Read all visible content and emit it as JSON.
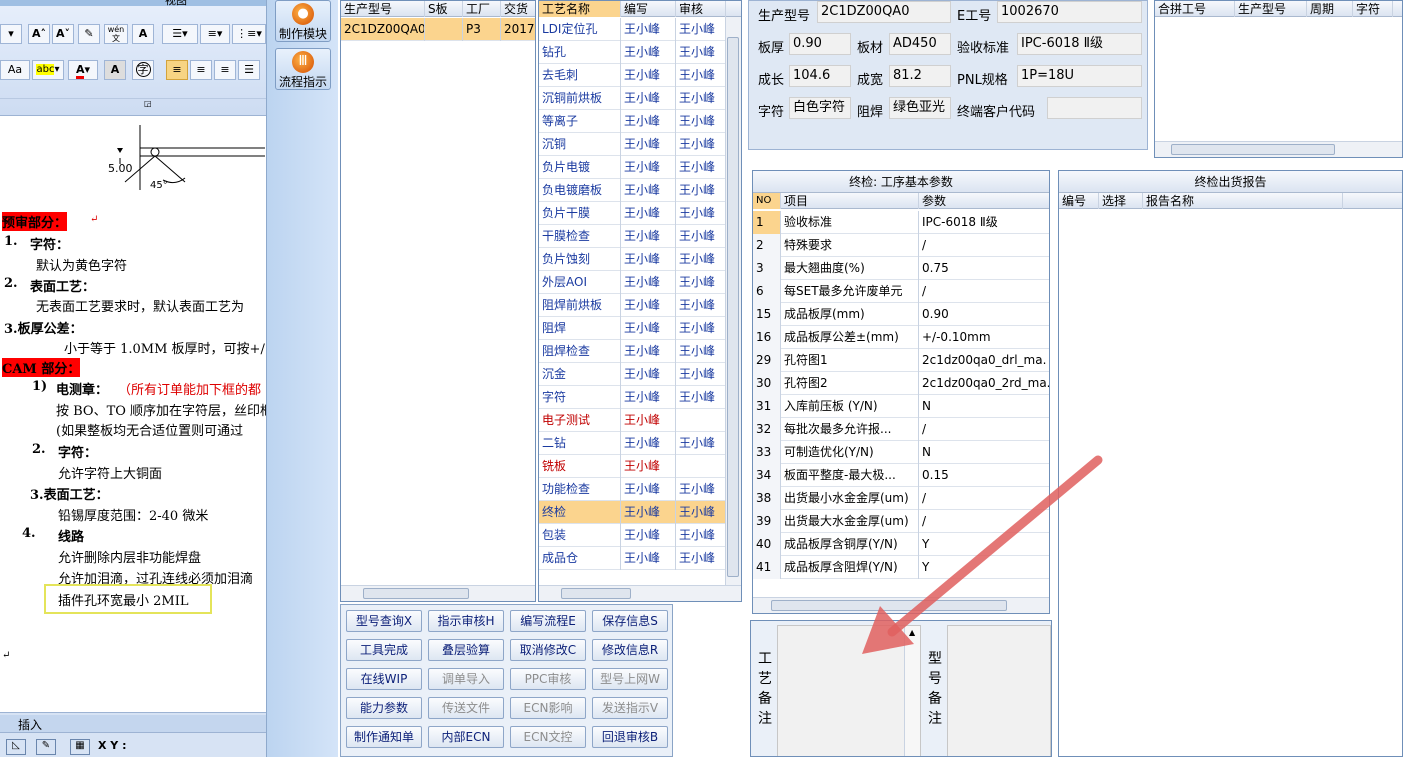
{
  "word": {
    "ribbon_tabs": [
      "视图"
    ],
    "ribbon": {
      "size_up": "A",
      "size_down": "A",
      "font_a": "A",
      "case_aa": "Aa",
      "abc": "abc",
      "font_color_a": "A",
      "char_a": "A",
      "circle": "字"
    },
    "doc": {
      "dim_label": "5.00",
      "angle_label": "45°",
      "s1": "预审部分：",
      "i1_num": "1.",
      "i1": "字符：",
      "i1_text": "默认为黄色字符",
      "i2_num": "2.",
      "i2": "表面工艺：",
      "i2_text": "无表面工艺要求时，默认表面工艺为",
      "i3": "3.板厚公差：",
      "i3_text": "小于等于 1.0MM 板厚时，可按+/",
      "s2": "CAM 部分：",
      "c1_num": "1)",
      "c1": "电测章：",
      "c1_red": "（所有订单能加下框的都",
      "c1_t1": "按 BO、TO 顺序加在字符层，丝印框",
      "c1_t2": "(如果整板均无合适位置则可通过",
      "c2_num": "2.",
      "c2": "字符：",
      "c2_t": "允许字符上大铜面",
      "c3": "3.表面工艺：",
      "c3_t": "铅锡厚度范围：2-40 微米",
      "c4_num": "4.",
      "c4": "线路",
      "c4_t1": "允许删除内层非功能焊盘",
      "c4_t2": "允许加泪滴，过孔连线必须加泪滴",
      "c4_t3": "插件孔环宽最小 2MIL"
    },
    "status": {
      "insert": "插入",
      "xy": "X Y :"
    }
  },
  "strip": {
    "make_module": "制作模块",
    "flow_guide": "流程指示"
  },
  "model_grid": {
    "headers": [
      "生产型号",
      "S板",
      "工厂",
      "交货"
    ],
    "rows": [
      [
        "2C1DZ00QA0",
        "",
        "P3",
        "2017"
      ]
    ]
  },
  "process_grid": {
    "headers": [
      "工艺名称",
      "编写",
      "审核"
    ],
    "rows": [
      [
        "LDI定位孔",
        "王小峰",
        "王小峰"
      ],
      [
        "钻孔",
        "王小峰",
        "王小峰"
      ],
      [
        "去毛刺",
        "王小峰",
        "王小峰"
      ],
      [
        "沉铜前烘板",
        "王小峰",
        "王小峰"
      ],
      [
        "等离子",
        "王小峰",
        "王小峰"
      ],
      [
        "沉铜",
        "王小峰",
        "王小峰"
      ],
      [
        "负片电镀",
        "王小峰",
        "王小峰"
      ],
      [
        "负电镀磨板",
        "王小峰",
        "王小峰"
      ],
      [
        "负片干膜",
        "王小峰",
        "王小峰"
      ],
      [
        "干膜检查",
        "王小峰",
        "王小峰"
      ],
      [
        "负片蚀刻",
        "王小峰",
        "王小峰"
      ],
      [
        "外层AOI",
        "王小峰",
        "王小峰"
      ],
      [
        "阻焊前烘板",
        "王小峰",
        "王小峰"
      ],
      [
        "阻焊",
        "王小峰",
        "王小峰"
      ],
      [
        "阻焊检查",
        "王小峰",
        "王小峰"
      ],
      [
        "沉金",
        "王小峰",
        "王小峰"
      ],
      [
        "字符",
        "王小峰",
        "王小峰"
      ],
      [
        "电子测试",
        "王小峰",
        ""
      ],
      [
        "二钻",
        "王小峰",
        "王小峰"
      ],
      [
        "铣板",
        "王小峰",
        ""
      ],
      [
        "功能检查",
        "王小峰",
        "王小峰"
      ],
      [
        "终检",
        "王小峰",
        "王小峰"
      ],
      [
        "包装",
        "王小峰",
        "王小峰"
      ],
      [
        "成品仓",
        "王小峰",
        "王小峰"
      ]
    ]
  },
  "buttons": [
    [
      "型号查询X",
      "指示审核H",
      "编写流程E",
      "保存信息S"
    ],
    [
      "工具完成",
      "叠层验算",
      "取消修改C",
      "修改信息R"
    ],
    [
      "在线WIP",
      "调单导入",
      "PPC审核",
      "型号上网W"
    ],
    [
      "能力参数",
      "传送文件",
      "ECN影响",
      "发送指示V"
    ],
    [
      "制作通知单",
      "内部ECN",
      "ECN文控",
      "回退审核B"
    ]
  ],
  "info": {
    "model_label": "生产型号",
    "model": "2C1DZ00QA0",
    "eno_label": "E工号",
    "eno": "1002670",
    "thick_label": "板厚",
    "thick": "0.90",
    "mat_label": "板材",
    "mat": "AD450",
    "std_label": "验收标准",
    "std": "IPC-6018 Ⅱ级",
    "len_label": "成长",
    "len": "104.6",
    "wid_label": "成宽",
    "wid": "81.2",
    "pnl_label": "PNL规格",
    "pnl": "1P=18U",
    "char_label": "字符",
    "char": "白色字符",
    "mask_label": "阻焊",
    "mask": "绿色亚光",
    "cust_label": "终端客户代码",
    "cust": ""
  },
  "merge_grid": {
    "headers": [
      "合拼工号",
      "生产型号",
      "周期",
      "字符"
    ]
  },
  "param_grid": {
    "title": "终检: 工序基本参数",
    "headers": [
      "NO",
      "项目",
      "参数"
    ],
    "rows": [
      [
        "1",
        "验收标准",
        "IPC-6018 Ⅱ级"
      ],
      [
        "2",
        "特殊要求",
        "/"
      ],
      [
        "3",
        "最大翘曲度(%)",
        "0.75"
      ],
      [
        "6",
        "每SET最多允许废单元",
        "/"
      ],
      [
        "15",
        "成品板厚(mm)",
        "0.90"
      ],
      [
        "16",
        "成品板厚公差±(mm)",
        "+/-0.10mm"
      ],
      [
        "29",
        "孔符图1",
        "2c1dz00qa0_drl_ma."
      ],
      [
        "30",
        "孔符图2",
        "2c1dz00qa0_2rd_ma."
      ],
      [
        "31",
        "入库前压板 (Y/N)",
        "N"
      ],
      [
        "32",
        "每批次最多允许报...",
        "/"
      ],
      [
        "33",
        "可制造优化(Y/N)",
        "N"
      ],
      [
        "34",
        "板面平整度-最大极...",
        "0.15"
      ],
      [
        "38",
        "出货最小水金金厚(um)",
        "/"
      ],
      [
        "39",
        "出货最大水金金厚(um)",
        "/"
      ],
      [
        "40",
        "成品板厚含铜厚(Y/N)",
        "Y"
      ],
      [
        "41",
        "成品板厚含阻焊(Y/N)",
        "Y"
      ]
    ]
  },
  "report_grid": {
    "title": "终检出货报告",
    "headers": [
      "编号",
      "选择",
      "报告名称"
    ]
  },
  "notes": {
    "process_note": "工艺备注",
    "model_note": "型号备注"
  }
}
